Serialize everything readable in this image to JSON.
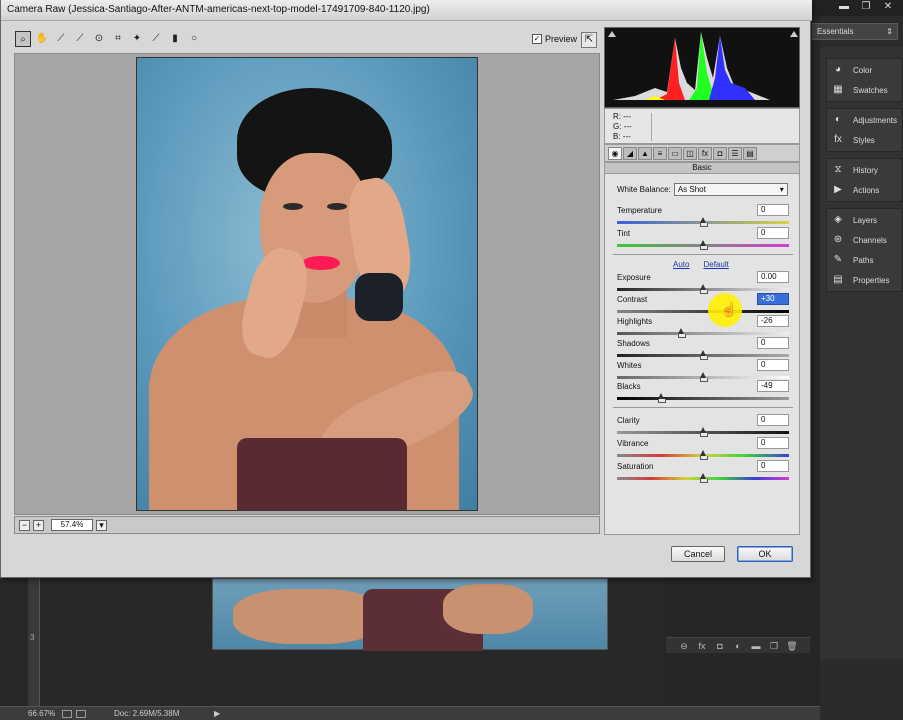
{
  "dialog": {
    "title": "Camera Raw (Jessica-Santiago-After-ANTM-americas-next-top-model-17491709-840-1120.jpg)",
    "preview_label": "Preview",
    "preview_checked": "✓",
    "zoom_value": "57.4%",
    "buttons": {
      "cancel": "Cancel",
      "ok": "OK"
    },
    "rgb": {
      "r": "R:  ---",
      "g": "G:  ---",
      "b": "B:  ---"
    },
    "panel_title": "Basic",
    "white_balance": {
      "label": "White Balance:",
      "value": "As Shot"
    },
    "links": {
      "auto": "Auto",
      "default": "Default"
    },
    "sliders": {
      "temperature": {
        "label": "Temperature",
        "value": "0"
      },
      "tint": {
        "label": "Tint",
        "value": "0"
      },
      "exposure": {
        "label": "Exposure",
        "value": "0.00"
      },
      "contrast": {
        "label": "Contrast",
        "value": "+30"
      },
      "highlights": {
        "label": "Highlights",
        "value": "-26"
      },
      "shadows": {
        "label": "Shadows",
        "value": "0"
      },
      "whites": {
        "label": "Whites",
        "value": "0"
      },
      "blacks": {
        "label": "Blacks",
        "value": "-49"
      },
      "clarity": {
        "label": "Clarity",
        "value": "0"
      },
      "vibrance": {
        "label": "Vibrance",
        "value": "0"
      },
      "saturation": {
        "label": "Saturation",
        "value": "0"
      }
    }
  },
  "photoshop": {
    "workspace": "Essentials",
    "panels": {
      "group1": [
        "Color",
        "Swatches"
      ],
      "group2": [
        "Adjustments",
        "Styles"
      ],
      "group3": [
        "History",
        "Actions"
      ],
      "group4": [
        "Layers",
        "Channels",
        "Paths",
        "Properties"
      ]
    },
    "status": {
      "zoom": "66.67%",
      "doc": "Doc: 2.69M/5.38M"
    },
    "ruler_mark": "3"
  },
  "colors": {
    "accent": "#3b6fd6",
    "histogram_red": "#ff2020",
    "histogram_green": "#20ff20",
    "histogram_blue": "#3030ff",
    "cursor_highlight": "#ffee00"
  }
}
